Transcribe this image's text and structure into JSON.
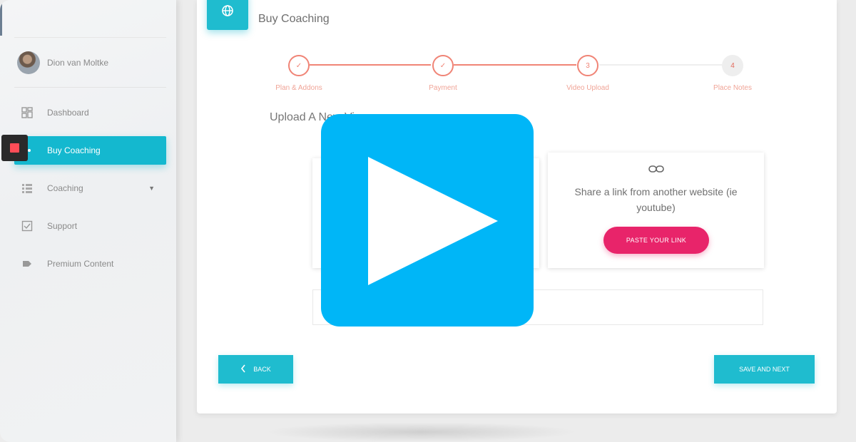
{
  "sidebar": {
    "user": {
      "name": "Dion van Moltke"
    },
    "items": [
      {
        "label": "Dashboard",
        "icon": "dashboard-icon",
        "active": false
      },
      {
        "label": "Buy Coaching",
        "icon": "coaching-icon",
        "active": true
      },
      {
        "label": "Coaching",
        "icon": "grid-icon",
        "active": false,
        "has_caret": true
      },
      {
        "label": "Support",
        "icon": "checkbox-icon",
        "active": false
      },
      {
        "label": "Premium Content",
        "icon": "tag-icon",
        "active": false
      }
    ]
  },
  "header": {
    "title": "Buy Coaching",
    "badge_icon": "globe-icon"
  },
  "stepper": {
    "steps": [
      {
        "label": "Plan & Addons",
        "mark": "✓",
        "state": "done"
      },
      {
        "label": "Payment",
        "mark": "✓",
        "state": "done"
      },
      {
        "label": "Video Upload",
        "mark": "3",
        "state": "current"
      },
      {
        "label": "Place Notes",
        "mark": "4",
        "state": "todo"
      }
    ],
    "colors": {
      "done": "#f08476",
      "todo": "#eeeeee"
    }
  },
  "upload": {
    "section_title": "Upload A New Vi",
    "link_option": {
      "icon": "link-icon",
      "text": "Share a link from another website (ie youtube)",
      "button_label": "PASTE YOUR LINK"
    }
  },
  "footer": {
    "back_label": "BACK",
    "next_label": "SAVE AND NEXT"
  },
  "overlay": {
    "icon": "play-icon",
    "color": "#00b6f7"
  },
  "colors": {
    "accent": "#1fbccf",
    "pink": "#e8246a"
  }
}
